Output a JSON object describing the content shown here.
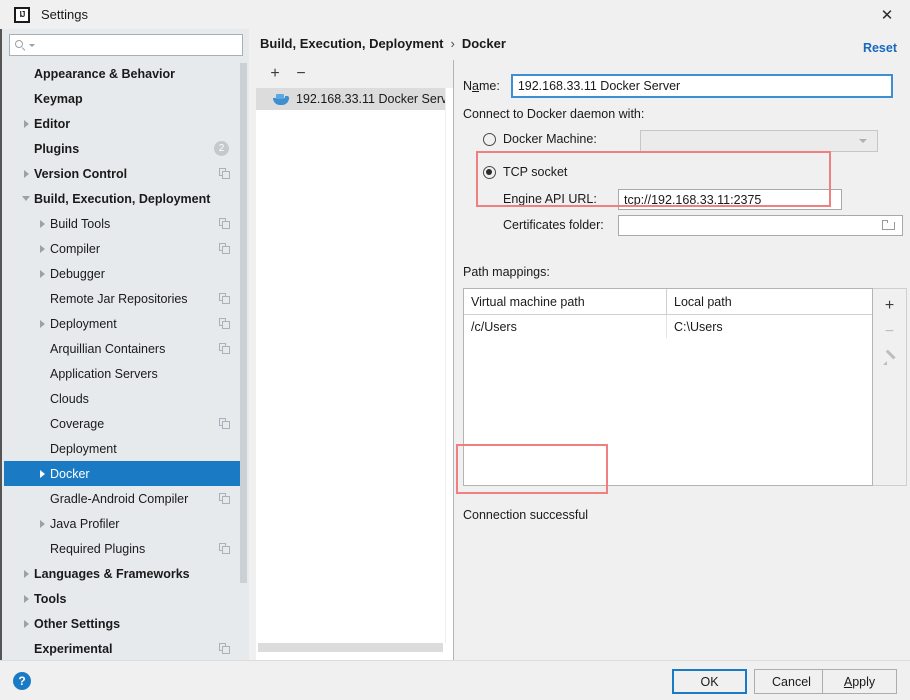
{
  "window": {
    "title": "Settings",
    "app_icon": "intellij-idea-icon",
    "close_icon": "close-icon"
  },
  "search": {
    "value": "",
    "placeholder": "",
    "icon": "search-icon",
    "caret_icon": "chevron-down-icon"
  },
  "tree": {
    "items": [
      {
        "label": "Appearance & Behavior",
        "level": 0,
        "bold": true,
        "arrow": "none",
        "badge": null,
        "copy": false
      },
      {
        "label": "Keymap",
        "level": 0,
        "bold": true,
        "arrow": "none",
        "badge": null,
        "copy": false
      },
      {
        "label": "Editor",
        "level": 0,
        "bold": true,
        "arrow": "right",
        "badge": null,
        "copy": false
      },
      {
        "label": "Plugins",
        "level": 0,
        "bold": true,
        "arrow": "none",
        "badge": "2",
        "copy": false
      },
      {
        "label": "Version Control",
        "level": 0,
        "bold": true,
        "arrow": "right",
        "badge": null,
        "copy": true
      },
      {
        "label": "Build, Execution, Deployment",
        "level": 0,
        "bold": true,
        "arrow": "down",
        "badge": null,
        "copy": false
      },
      {
        "label": "Build Tools",
        "level": 1,
        "bold": false,
        "arrow": "right",
        "badge": null,
        "copy": true
      },
      {
        "label": "Compiler",
        "level": 1,
        "bold": false,
        "arrow": "right",
        "badge": null,
        "copy": true
      },
      {
        "label": "Debugger",
        "level": 1,
        "bold": false,
        "arrow": "right",
        "badge": null,
        "copy": false
      },
      {
        "label": "Remote Jar Repositories",
        "level": 1,
        "bold": false,
        "arrow": "none",
        "badge": null,
        "copy": true
      },
      {
        "label": "Deployment",
        "level": 1,
        "bold": false,
        "arrow": "right",
        "badge": null,
        "copy": true
      },
      {
        "label": "Arquillian Containers",
        "level": 1,
        "bold": false,
        "arrow": "none",
        "badge": null,
        "copy": true
      },
      {
        "label": "Application Servers",
        "level": 1,
        "bold": false,
        "arrow": "none",
        "badge": null,
        "copy": false
      },
      {
        "label": "Clouds",
        "level": 1,
        "bold": false,
        "arrow": "none",
        "badge": null,
        "copy": false
      },
      {
        "label": "Coverage",
        "level": 1,
        "bold": false,
        "arrow": "none",
        "badge": null,
        "copy": true
      },
      {
        "label": "Deployment",
        "level": 1,
        "bold": false,
        "arrow": "none",
        "badge": null,
        "copy": false
      },
      {
        "label": "Docker",
        "level": 1,
        "bold": false,
        "arrow": "right",
        "badge": null,
        "copy": false,
        "selected": true
      },
      {
        "label": "Gradle-Android Compiler",
        "level": 1,
        "bold": false,
        "arrow": "none",
        "badge": null,
        "copy": true
      },
      {
        "label": "Java Profiler",
        "level": 1,
        "bold": false,
        "arrow": "right",
        "badge": null,
        "copy": false
      },
      {
        "label": "Required Plugins",
        "level": 1,
        "bold": false,
        "arrow": "none",
        "badge": null,
        "copy": true
      },
      {
        "label": "Languages & Frameworks",
        "level": 0,
        "bold": true,
        "arrow": "right",
        "badge": null,
        "copy": false
      },
      {
        "label": "Tools",
        "level": 0,
        "bold": true,
        "arrow": "right",
        "badge": null,
        "copy": false
      },
      {
        "label": "Other Settings",
        "level": 0,
        "bold": true,
        "arrow": "right",
        "badge": null,
        "copy": false
      },
      {
        "label": "Experimental",
        "level": 0,
        "bold": true,
        "arrow": "none",
        "badge": null,
        "copy": true
      }
    ]
  },
  "breadcrumb": {
    "parent": "Build, Execution, Deployment",
    "separator": "›",
    "current": "Docker"
  },
  "reset_link": "Reset",
  "server_list": {
    "add_label": "+",
    "remove_label": "−",
    "items": [
      {
        "label": "192.168.33.11 Docker Serv",
        "icon": "docker-whale-icon",
        "selected": true
      }
    ]
  },
  "form": {
    "name_label": "N",
    "name_label_mnemonic": "a",
    "name_label_rest": "me:",
    "name_value": "192.168.33.11 Docker Server",
    "connect_label": "Connect to Docker daemon with:",
    "docker_machine_label": "Docker Machine:",
    "docker_machine_value": "",
    "docker_machine_selected": false,
    "tcp_socket_label": "TCP socket",
    "tcp_socket_selected": true,
    "engine_api_label": "Engine API URL:",
    "engine_api_value": "tcp://192.168.33.11:2375",
    "certificates_label": "Certificates folder:",
    "certificates_value": "",
    "certificates_browse_icon": "folder-icon",
    "path_mappings_label": "Path mappings:"
  },
  "table": {
    "columns": [
      "Virtual machine path",
      "Local path"
    ],
    "rows": [
      [
        "/c/Users",
        "C:\\Users"
      ]
    ],
    "buttons": [
      {
        "name": "add",
        "label": "+",
        "enabled": true
      },
      {
        "name": "remove",
        "label": "−",
        "enabled": false
      },
      {
        "name": "edit",
        "label": "pencil-icon",
        "enabled": false
      }
    ]
  },
  "status": {
    "text": "Connection successful"
  },
  "footer": {
    "help_label": "?",
    "ok_label": "OK",
    "cancel_label": "Cancel",
    "apply_label_mnemonic": "A",
    "apply_label_rest": "pply"
  },
  "colors": {
    "accent_blue": "#1a7bc4",
    "link_blue": "#1668c1",
    "selection_blue": "#1a7bc4",
    "annotation_red": "#f08080",
    "sidebar_bg": "#e6eaed",
    "window_bg": "#f0f0f0",
    "docker_blue": "#3d8fd1"
  }
}
